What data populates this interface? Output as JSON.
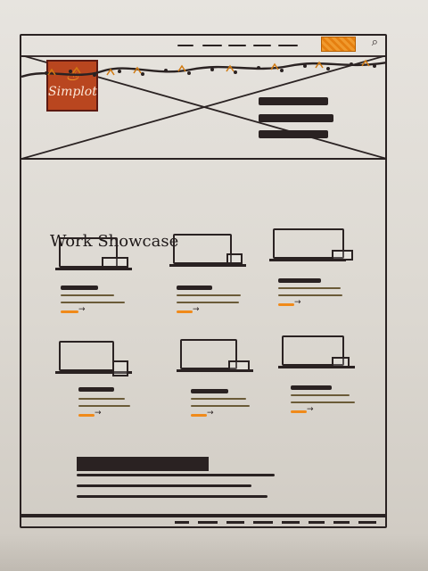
{
  "header": {
    "logo_text": "Simplot",
    "search_icon": "search-icon",
    "accent_color": "#f09a2e",
    "logo_color": "#b9461f"
  },
  "main": {
    "section_title": "Work Showcase",
    "cards": [
      {
        "id": "card-1"
      },
      {
        "id": "card-2"
      },
      {
        "id": "card-3"
      },
      {
        "id": "card-4"
      },
      {
        "id": "card-5"
      },
      {
        "id": "card-6"
      }
    ]
  }
}
